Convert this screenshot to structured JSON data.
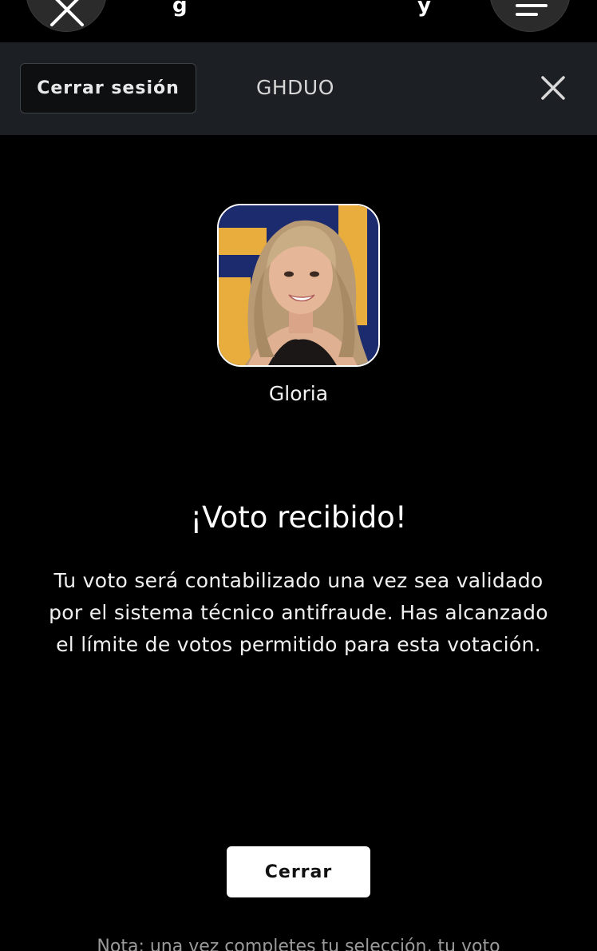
{
  "header": {
    "title_fragment_left": "g",
    "title_fragment_right": "y"
  },
  "session_bar": {
    "logout_label": "Cerrar sesión",
    "user_code": "GHDUO"
  },
  "candidate": {
    "name": "Gloria"
  },
  "confirmation": {
    "title": "¡Voto recibido!",
    "message": "Tu voto será contabilizado una vez sea validado por el sistema técnico antifraude. Has alcanzado el límite de votos permitido para esta votación.",
    "close_label": "Cerrar"
  },
  "footer": {
    "note": "Nota: una vez completes tu selección, tu voto"
  },
  "colors": {
    "background": "#000000",
    "session_bar": "#1c2024",
    "photo_blue": "#1c2a6e",
    "photo_yellow": "#e8ad3c"
  }
}
